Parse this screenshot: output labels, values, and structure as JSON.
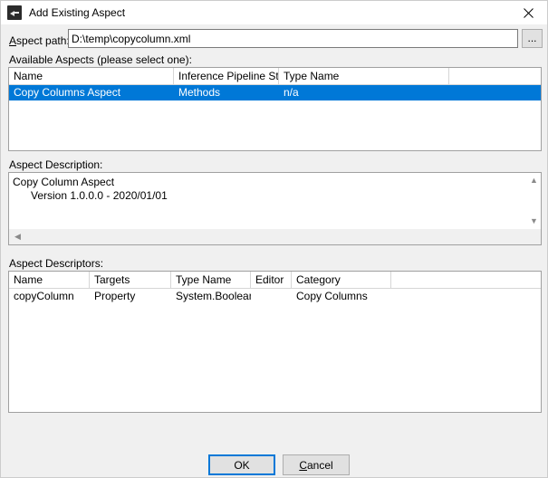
{
  "window": {
    "title": "Add Existing Aspect",
    "icon": "aspect-icon",
    "close_icon": "close-icon",
    "accent_color": "#0078d7",
    "background_color": "#f0f0f0"
  },
  "path_row": {
    "label_prefix": "A",
    "label_rest": "spect path:",
    "value": "D:\\temp\\copycolumn.xml",
    "placeholder": "",
    "browse_label": "..."
  },
  "available": {
    "label": "Available Aspects (please select one):",
    "columns": [
      "Name",
      "Inference Pipeline Step",
      "Type Name",
      ""
    ],
    "rows": [
      {
        "name": "Copy Columns Aspect",
        "step": "Methods",
        "type": "n/a",
        "selected": true
      }
    ]
  },
  "description": {
    "label": "Aspect Description:",
    "text": "Copy Column Aspect\n      Version 1.0.0.0 - 2020/01/01",
    "scroll_up_icon": "chevron-up-icon",
    "scroll_down_icon": "chevron-down-icon",
    "scroll_left_icon": "chevron-left-icon",
    "scroll_right_icon": "chevron-right-icon"
  },
  "descriptors": {
    "label": "Aspect Descriptors:",
    "columns": [
      "Name",
      "Targets",
      "Type Name",
      "Editor",
      "Category",
      ""
    ],
    "rows": [
      {
        "name": "copyColumn",
        "targets": "Property",
        "type": "System.Boolean",
        "editor": "",
        "category": "Copy Columns"
      }
    ]
  },
  "footer": {
    "ok_label": "OK",
    "cancel_prefix": "C",
    "cancel_rest": "ancel"
  }
}
